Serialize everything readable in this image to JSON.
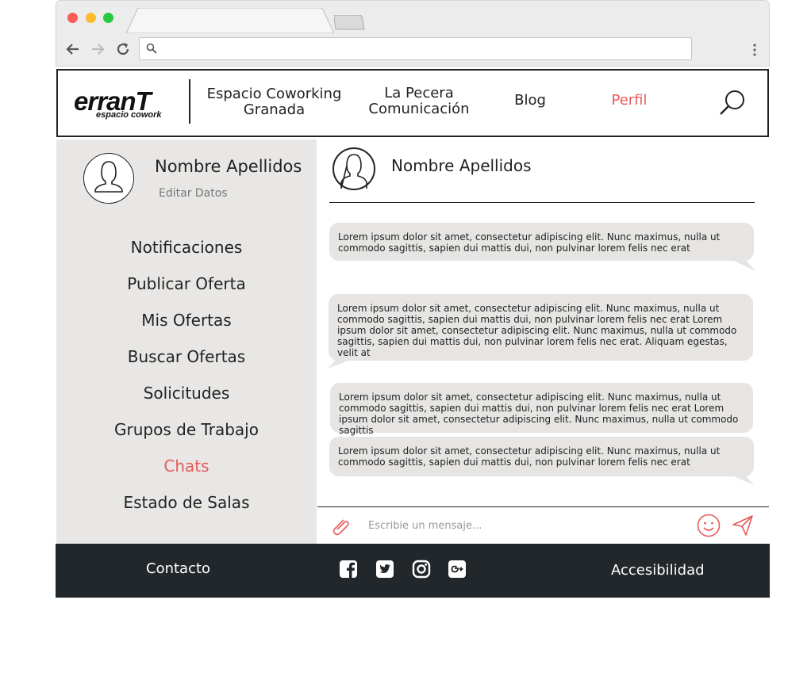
{
  "browser": {
    "address_value": ""
  },
  "nav": {
    "logo_main": "erranT",
    "logo_sub": "espacio cowork",
    "items": [
      {
        "label_line1": "Espacio Coworking",
        "label_line2": "Granada"
      },
      {
        "label_line1": "La Pecera",
        "label_line2": "Comunicación"
      },
      {
        "label_line1": "Blog",
        "label_line2": ""
      },
      {
        "label_line1": "Perfil",
        "label_line2": ""
      }
    ],
    "active_color": "#e85a5a"
  },
  "sidebar": {
    "user_name": "Nombre Apellidos",
    "edit_label": "Editar Datos",
    "menu": [
      "Notificaciones",
      "Publicar Oferta",
      "Mis Ofertas",
      "Buscar Ofertas",
      "Solicitudes",
      "Grupos de Trabajo",
      "Chats",
      "Estado de Salas"
    ],
    "active_item": "Chats"
  },
  "chat": {
    "contact_name": "Nombre Apellidos",
    "messages": [
      "Lorem ipsum dolor sit amet, consectetur adipiscing elit. Nunc maximus, nulla ut commodo sagittis, sapien dui mattis dui, non pulvinar lorem felis nec erat",
      "Lorem ipsum dolor sit amet, consectetur adipiscing elit. Nunc maximus, nulla ut commodo sagittis, sapien dui mattis dui, non pulvinar lorem felis nec erat Lorem ipsum dolor sit amet, consectetur adipiscing elit. Nunc maximus, nulla ut commodo sagittis, sapien dui mattis dui, non pulvinar lorem felis nec erat. Aliquam egestas, velit at",
      "Lorem ipsum dolor sit amet, consectetur adipiscing elit. Nunc maximus, nulla ut commodo sagittis, sapien dui mattis dui, non pulvinar lorem felis nec erat Lorem ipsum dolor sit amet, consectetur adipiscing elit. Nunc maximus, nulla ut commodo sagittis",
      "Lorem ipsum dolor sit amet, consectetur adipiscing elit. Nunc maximus, nulla ut commodo sagittis, sapien dui mattis dui, non pulvinar lorem felis nec erat"
    ],
    "composer_placeholder": "Escribie un mensaje..."
  },
  "footer": {
    "contact_label": "Contacto",
    "accessibility_label": "Accesibilidad",
    "social_icons": [
      "facebook-icon",
      "twitter-icon",
      "instagram-icon",
      "google-plus-icon"
    ]
  }
}
